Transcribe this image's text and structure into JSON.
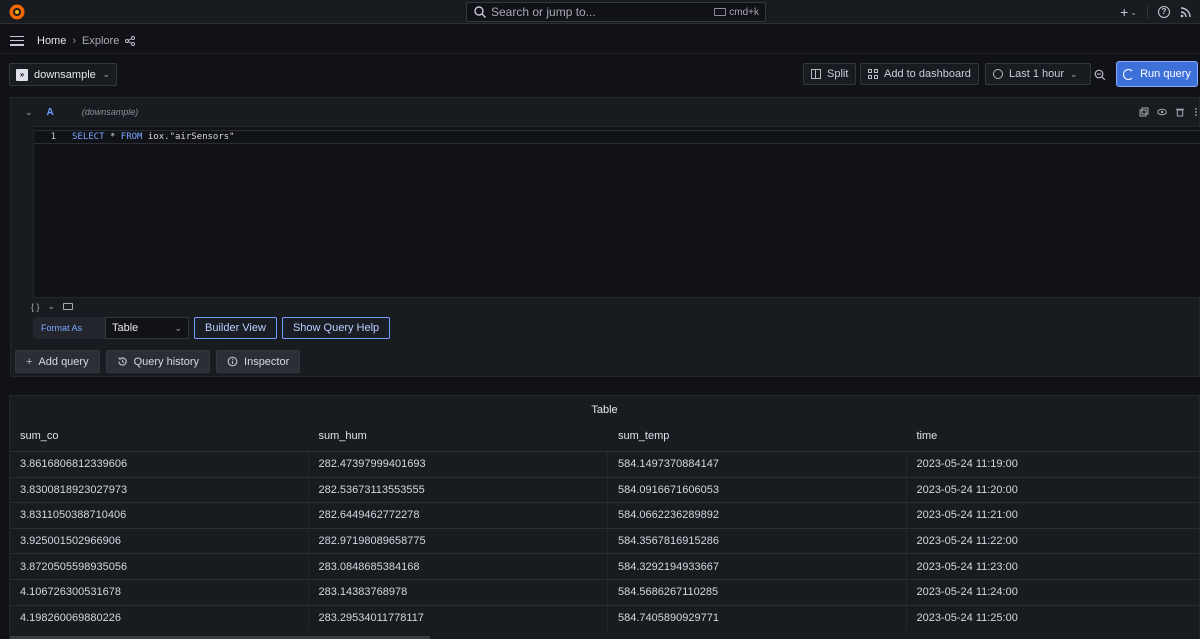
{
  "topbar": {
    "search_placeholder": "Search or jump to...",
    "shortcut": "cmd+k",
    "plus_label": "+"
  },
  "breadcrumb": {
    "home": "Home",
    "separator": "›",
    "current": "Explore"
  },
  "toolbar": {
    "datasource": "downsample",
    "split_label": "Split",
    "add_to_dashboard_label": "Add to dashboard",
    "time_range_label": "Last 1 hour",
    "run_query_label": "Run query",
    "run_query_color": "#3d71d9"
  },
  "query": {
    "collapse_glyph": "⌄",
    "ref_id": "A",
    "datasource_hint": "(downsample)",
    "line_number": "1",
    "sql_select": "SELECT",
    "sql_star": "*",
    "sql_from": "FROM",
    "sql_table": "iox.\"airSensors\"",
    "footer_braces": "{ }",
    "footer_chevron": "⌄",
    "format_as_label": "Format As",
    "format_value": "Table",
    "builder_view_label": "Builder View",
    "show_query_help_label": "Show Query Help"
  },
  "actions": {
    "add_query_label": "Add query",
    "query_history_label": "Query history",
    "inspector_label": "Inspector"
  },
  "results": {
    "title": "Table",
    "columns": [
      "sum_co",
      "sum_hum",
      "sum_temp",
      "time"
    ],
    "rows": [
      [
        "3.8616806812339606",
        "282.47397999401693",
        "584.1497370884147",
        "2023-05-24 11:19:00"
      ],
      [
        "3.8300818923027973",
        "282.53673113553555",
        "584.0916671606053",
        "2023-05-24 11:20:00"
      ],
      [
        "3.8311050388710406",
        "282.6449462772278",
        "584.0662236289892",
        "2023-05-24 11:21:00"
      ],
      [
        "3.925001502966906",
        "282.97198089658775",
        "584.3567816915286",
        "2023-05-24 11:22:00"
      ],
      [
        "3.8720505598935056",
        "283.0848685384168",
        "584.3292194933667",
        "2023-05-24 11:23:00"
      ],
      [
        "4.106726300531678",
        "283.14383768978",
        "584.5686267110285",
        "2023-05-24 11:24:00"
      ],
      [
        "4.198260069880226",
        "283.29534011778117",
        "584.7405890929771",
        "2023-05-24 11:25:00"
      ]
    ]
  }
}
